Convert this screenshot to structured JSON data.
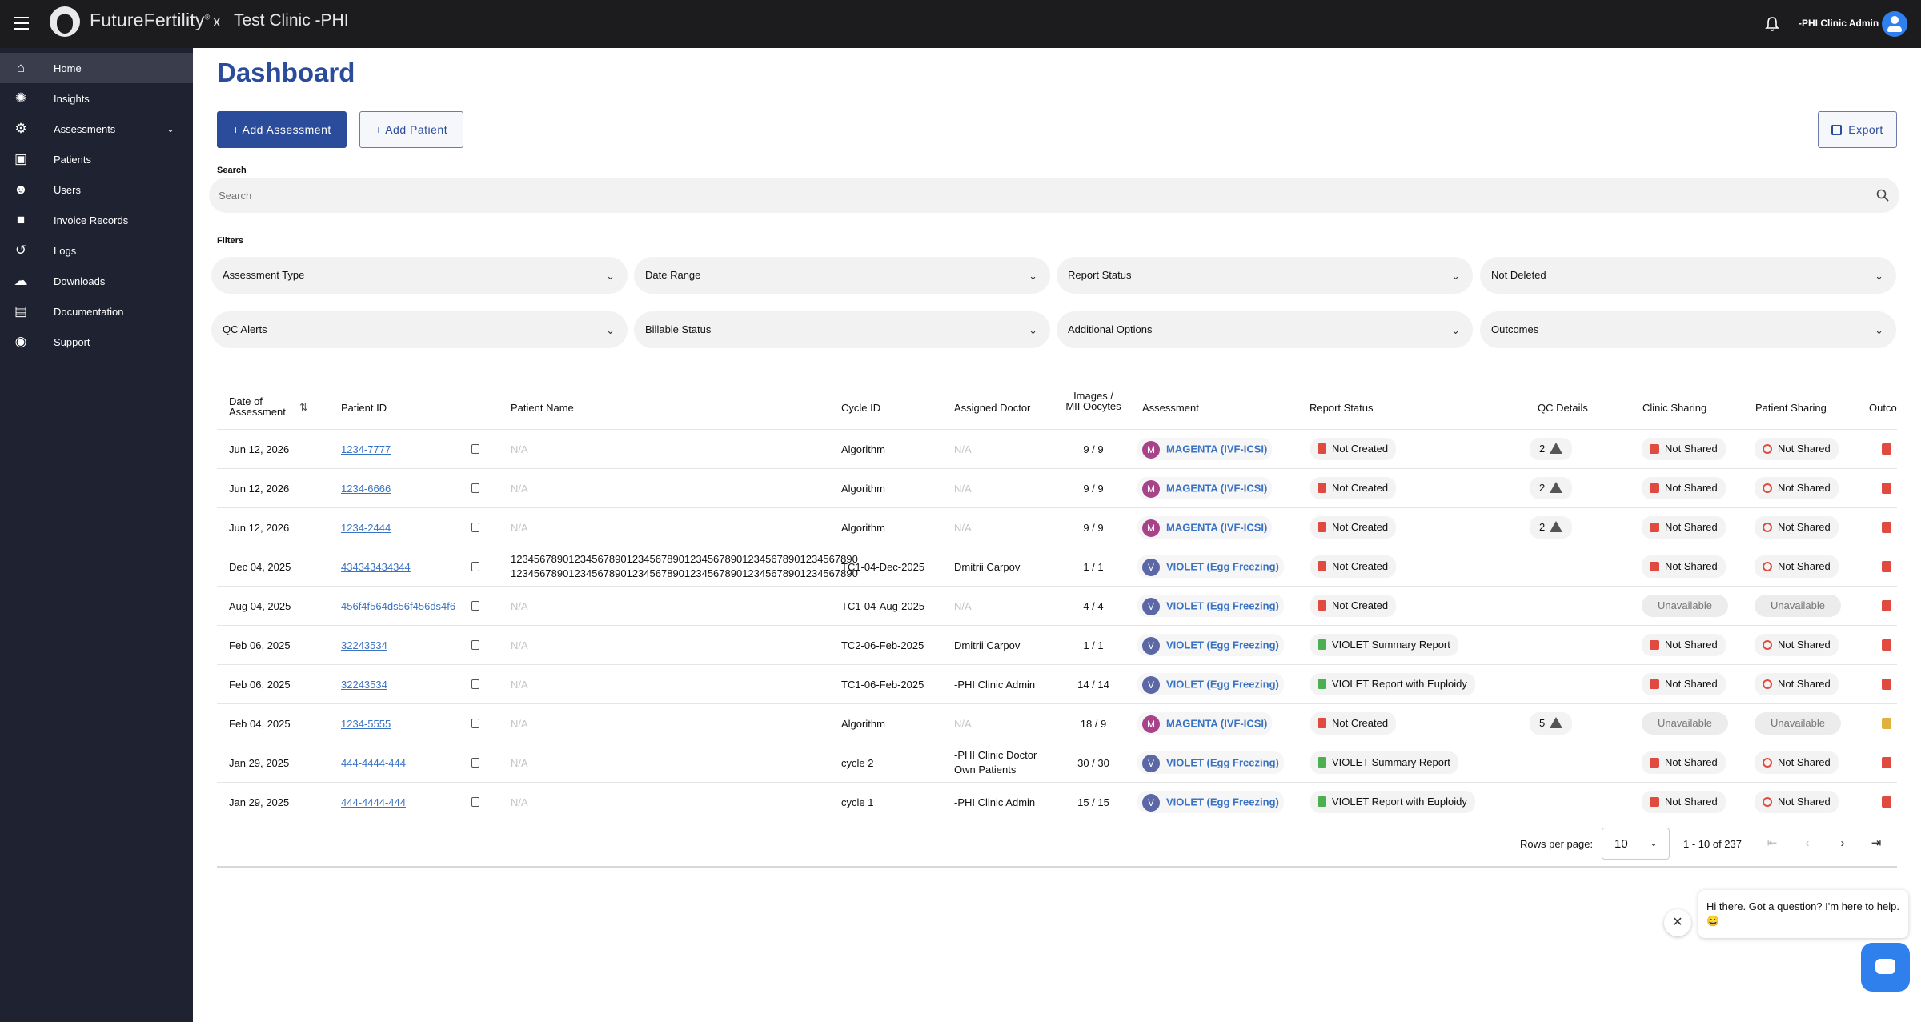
{
  "header": {
    "brand": "FutureFertility",
    "brand_mark": "®",
    "separator": "x",
    "clinic": "Test Clinic -PHI",
    "user": "-PHI Clinic Admin",
    "icons": [
      "menu-icon",
      "bell-icon",
      "user-avatar-icon"
    ]
  },
  "sidebar": {
    "items": [
      {
        "label": "Home",
        "icon": "home-icon",
        "active": true
      },
      {
        "label": "Insights",
        "icon": "lightbulb-icon"
      },
      {
        "label": "Assessments",
        "icon": "assessment-icon",
        "expandable": true
      },
      {
        "label": "Patients",
        "icon": "clipboard-icon"
      },
      {
        "label": "Users",
        "icon": "users-icon"
      },
      {
        "label": "Invoice Records",
        "icon": "invoice-icon"
      },
      {
        "label": "Logs",
        "icon": "history-icon"
      },
      {
        "label": "Downloads",
        "icon": "cloud-download-icon"
      },
      {
        "label": "Documentation",
        "icon": "document-icon"
      },
      {
        "label": "Support",
        "icon": "support-icon"
      }
    ]
  },
  "main": {
    "title": "Dashboard",
    "add_assessment": "+ Add Assessment",
    "add_patient": "+ Add Patient",
    "export": "Export",
    "search_label": "Search",
    "search_placeholder": "Search",
    "filters_label": "Filters",
    "filters": [
      "Assessment Type",
      "Date Range",
      "Report Status",
      "Not Deleted",
      "QC Alerts",
      "Billable Status",
      "Additional Options",
      "Outcomes"
    ]
  },
  "table": {
    "headers": {
      "date": "Date of Assessment",
      "patient_id": "Patient ID",
      "patient_name": "Patient Name",
      "cycle_id": "Cycle ID",
      "doctor": "Assigned Doctor",
      "images": "Images / MII Oocytes",
      "assessment": "Assessment",
      "report": "Report Status",
      "qc": "QC Details",
      "clinic_sharing": "Clinic Sharing",
      "patient_sharing": "Patient Sharing",
      "outcomes": "Outcomes"
    },
    "rows": [
      {
        "date": "Jun 12, 2026",
        "pid": "1234-7777",
        "name": "N/A",
        "name2": "",
        "cycle": "Algorithm",
        "doctor": "N/A",
        "doctor2": "",
        "images": "9 / 9",
        "abadge": "M",
        "assess": "MAGENTA (IVF-ICSI)",
        "report": "Not Created",
        "report_ok": false,
        "qc": "2",
        "clinic": "Not Shared",
        "patient": "Not Shared"
      },
      {
        "date": "Jun 12, 2026",
        "pid": "1234-6666",
        "name": "N/A",
        "name2": "",
        "cycle": "Algorithm",
        "doctor": "N/A",
        "doctor2": "",
        "images": "9 / 9",
        "abadge": "M",
        "assess": "MAGENTA (IVF-ICSI)",
        "report": "Not Created",
        "report_ok": false,
        "qc": "2",
        "clinic": "Not Shared",
        "patient": "Not Shared"
      },
      {
        "date": "Jun 12, 2026",
        "pid": "1234-2444",
        "name": "N/A",
        "name2": "",
        "cycle": "Algorithm",
        "doctor": "N/A",
        "doctor2": "",
        "images": "9 / 9",
        "abadge": "M",
        "assess": "MAGENTA (IVF-ICSI)",
        "report": "Not Created",
        "report_ok": false,
        "qc": "2",
        "clinic": "Not Shared",
        "patient": "Not Shared"
      },
      {
        "date": "Dec 04, 2025",
        "pid": "434343434344",
        "name": "123456789012345678901234567890123456789012345678901234567890",
        "name2": "123456789012345678901234567890123456789012345678901234567890",
        "cycle": "TC1-04-Dec-2025",
        "doctor": "Dmitrii Carpov",
        "doctor2": "",
        "images": "1 / 1",
        "abadge": "V",
        "assess": "VIOLET (Egg Freezing)",
        "report": "Not Created",
        "report_ok": false,
        "qc": "",
        "clinic": "Not Shared",
        "patient": "Not Shared"
      },
      {
        "date": "Aug 04, 2025",
        "pid": "456f4f564ds56f456ds4f6",
        "name": "N/A",
        "name2": "",
        "cycle": "TC1-04-Aug-2025",
        "doctor": "N/A",
        "doctor2": "",
        "images": "4 / 4",
        "abadge": "V",
        "assess": "VIOLET (Egg Freezing)",
        "report": "Not Created",
        "report_ok": false,
        "qc": "",
        "clinic": "Unavailable",
        "patient": "Unavailable"
      },
      {
        "date": "Feb 06, 2025",
        "pid": "32243534",
        "name": "N/A",
        "name2": "",
        "cycle": "TC2-06-Feb-2025",
        "doctor": "Dmitrii Carpov",
        "doctor2": "",
        "images": "1 / 1",
        "abadge": "V",
        "assess": "VIOLET (Egg Freezing)",
        "report": "VIOLET Summary Report",
        "report_ok": true,
        "qc": "",
        "clinic": "Not Shared",
        "patient": "Not Shared"
      },
      {
        "date": "Feb 06, 2025",
        "pid": "32243534",
        "name": "N/A",
        "name2": "",
        "cycle": "TC1-06-Feb-2025",
        "doctor": "-PHI Clinic Admin",
        "doctor2": "",
        "images": "14 / 14",
        "abadge": "V",
        "assess": "VIOLET (Egg Freezing)",
        "report": "VIOLET Report with Euploidy",
        "report_ok": true,
        "qc": "",
        "clinic": "Not Shared",
        "patient": "Not Shared"
      },
      {
        "date": "Feb 04, 2025",
        "pid": "1234-5555",
        "name": "N/A",
        "name2": "",
        "cycle": "Algorithm",
        "doctor": "N/A",
        "doctor2": "",
        "images": "18 / 9",
        "abadge": "M",
        "assess": "MAGENTA (IVF-ICSI)",
        "report": "Not Created",
        "report_ok": false,
        "qc": "5",
        "clinic": "Unavailable",
        "patient": "Unavailable"
      },
      {
        "date": "Jan 29, 2025",
        "pid": "444-4444-444",
        "name": "N/A",
        "name2": "",
        "cycle": "cycle 2",
        "doctor": "-PHI Clinic Doctor",
        "doctor2": "Own Patients",
        "images": "30 / 30",
        "abadge": "V",
        "assess": "VIOLET (Egg Freezing)",
        "report": "VIOLET Summary Report",
        "report_ok": true,
        "qc": "",
        "clinic": "Not Shared",
        "patient": "Not Shared"
      },
      {
        "date": "Jan 29, 2025",
        "pid": "444-4444-444",
        "name": "N/A",
        "name2": "",
        "cycle": "cycle 1",
        "doctor": "-PHI Clinic Admin",
        "doctor2": "",
        "images": "15 / 15",
        "abadge": "V",
        "assess": "VIOLET (Egg Freezing)",
        "report": "VIOLET Report with Euploidy",
        "report_ok": true,
        "qc": "",
        "clinic": "Not Shared",
        "patient": "Not Shared"
      }
    ]
  },
  "pagination": {
    "rows_label": "Rows per page:",
    "rows_value": "10",
    "range": "1 - 10 of 237"
  },
  "chat": {
    "message": "Hi there. Got a question? I'm here to help. 😀"
  }
}
